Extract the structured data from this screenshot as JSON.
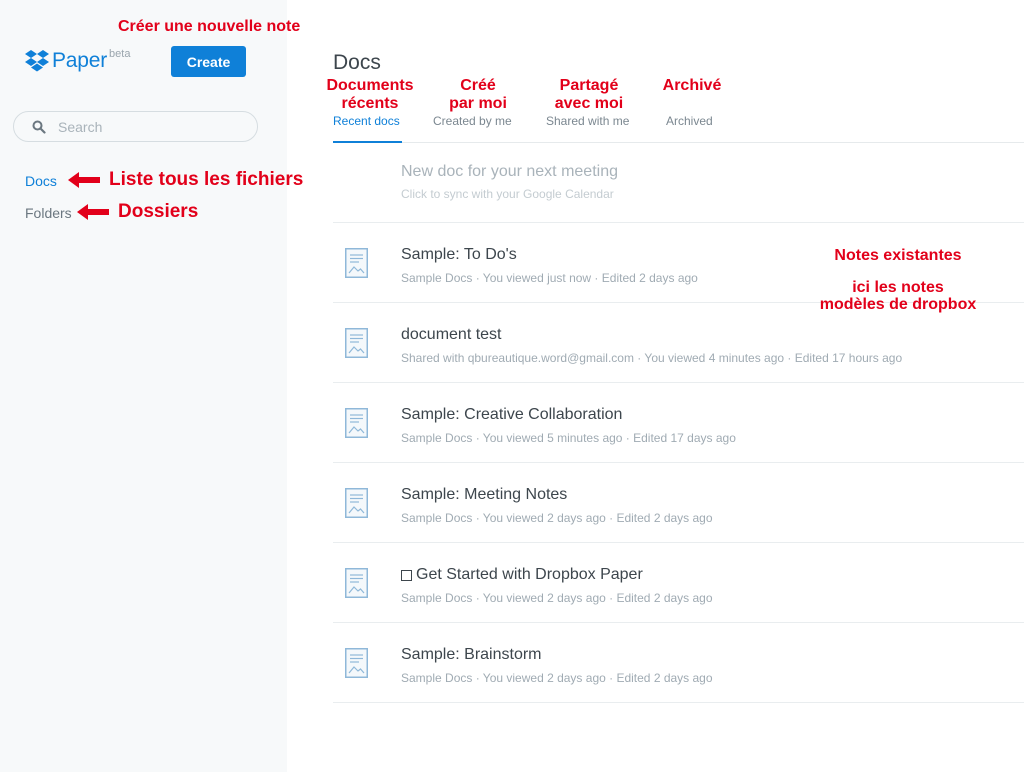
{
  "app": {
    "logo_text": "Paper",
    "logo_badge": "beta",
    "brand_color": "#0f80d8"
  },
  "toolbar": {
    "create_label": "Create"
  },
  "search": {
    "placeholder": "Search"
  },
  "sidebar": {
    "items": [
      {
        "label": "Docs",
        "active": true
      },
      {
        "label": "Folders",
        "active": false
      }
    ]
  },
  "main": {
    "title": "Docs",
    "tabs": [
      {
        "label": "Recent docs",
        "active": true
      },
      {
        "label": "Created by me",
        "active": false
      },
      {
        "label": "Shared with me",
        "active": false
      },
      {
        "label": "Archived",
        "active": false
      }
    ],
    "new_doc": {
      "title": "New doc for your next meeting",
      "subtitle": "Click to sync with your Google Calendar"
    },
    "docs": [
      {
        "title": "Sample: To Do's",
        "meta": "Sample Docs · You viewed just now · Edited 2 days ago",
        "has_checkbox": false,
        "icon": "document-icon"
      },
      {
        "title": "document test",
        "meta": "Shared with qbureautique.word@gmail.com · You viewed 4 minutes ago · Edited 17 hours ago",
        "has_checkbox": false,
        "icon": "document-icon"
      },
      {
        "title": "Sample: Creative Collaboration",
        "meta": "Sample Docs · You viewed 5 minutes ago · Edited 17 days ago",
        "has_checkbox": false,
        "icon": "document-icon"
      },
      {
        "title": "Sample: Meeting Notes",
        "meta": "Sample Docs · You viewed 2 days ago · Edited 2 days ago",
        "has_checkbox": false,
        "icon": "document-icon"
      },
      {
        "title": "Get Started with Dropbox Paper",
        "meta": "Sample Docs · You viewed 2 days ago · Edited 2 days ago",
        "has_checkbox": true,
        "icon": "document-icon"
      },
      {
        "title": "Sample: Brainstorm",
        "meta": "Sample Docs · You viewed 2 days ago · Edited 2 days ago",
        "has_checkbox": false,
        "icon": "document-icon"
      }
    ]
  },
  "annotations": {
    "color": "#e2001a",
    "create_note": "Créer une nouvelle note",
    "docs_list": "Liste tous les fichiers",
    "folders": "Dossiers",
    "tab_recent_1": "Documents",
    "tab_recent_2": "récents",
    "tab_created_1": "Créé",
    "tab_created_2": "par moi",
    "tab_shared_1": "Partagé",
    "tab_shared_2": "avec moi",
    "tab_archived": "Archivé",
    "notes_1": "Notes existantes",
    "notes_2": "ici les notes",
    "notes_3": "modèles de dropbox"
  }
}
